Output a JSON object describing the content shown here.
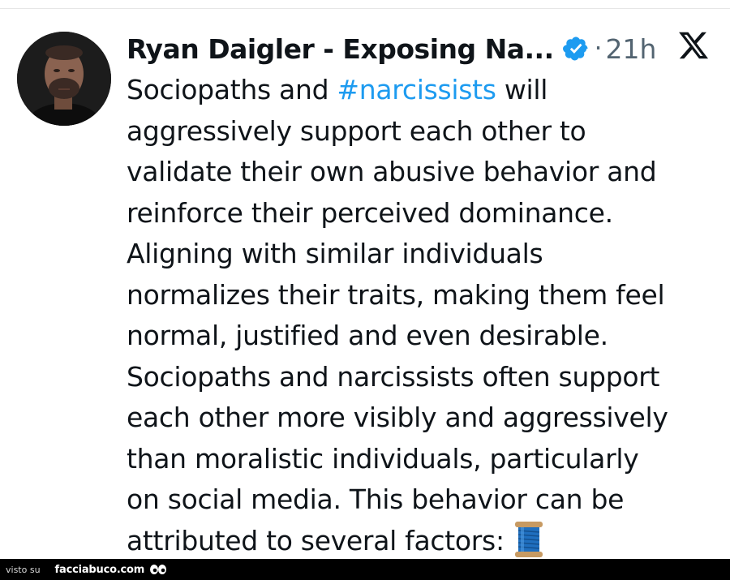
{
  "tweet": {
    "author_name": "Ryan Daigler - Exposing Na...",
    "separator": "·",
    "timestamp": "21h",
    "platform_icon": "x-logo-icon",
    "verified_icon": "verified-badge-icon",
    "hashtag_color": "#1d9bf0",
    "lines": {
      "l1_before": "Sociopaths and ",
      "l1_hashtag": "#narcissists",
      "l1_after": " will",
      "l2": "aggressively support each other to",
      "l3": "validate their own abusive behavior and",
      "l4": "reinforce their perceived dominance.",
      "l5": "Aligning with similar individuals",
      "l6": "normalizes their traits, making them feel",
      "l7": "normal, justified and even desirable.",
      "l8": "Sociopaths and narcissists often support",
      "l9": "each other more visibly and aggressively",
      "l10": "than moralistic individuals, particularly",
      "l11": "on social media. This behavior can be",
      "l12": "attributed to several factors:"
    },
    "thread_emoji_icon": "spool-of-thread-icon"
  },
  "footer": {
    "visto": "visto su",
    "brand": "facciabuco.com",
    "eyes_icon": "eyes-icon"
  }
}
